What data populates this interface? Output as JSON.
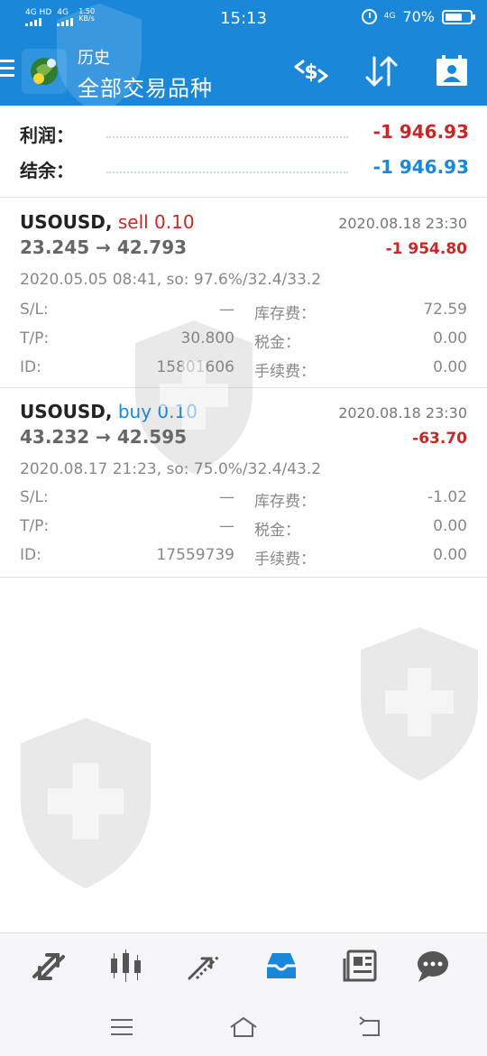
{
  "status_bar": {
    "sim1": "4G HD",
    "sim2": "4G",
    "speed_value": "1.50",
    "speed_unit": "KB/s",
    "time": "15:13",
    "network": "4G",
    "battery": "70%",
    "battery_level": 0.7,
    "icons": [
      "signal-icon",
      "alarm-icon",
      "battery-icon"
    ]
  },
  "app_bar": {
    "subtitle": "历史",
    "title": "全部交易品种",
    "colors": {
      "background": "#1a87d9",
      "text": "#ffffff"
    },
    "actions": [
      "currency-exchange-icon",
      "sort-icon",
      "calendar-icon"
    ]
  },
  "summary": {
    "profit_label": "利润：",
    "profit_value": "-1 946.93",
    "balance_label": "结余：",
    "balance_value": "-1 946.93"
  },
  "trades": [
    {
      "symbol": "USOUSD,",
      "side": "sell 0.10",
      "close_time": "2020.08.18 23:30",
      "prices": "23.245 → 42.793",
      "profit": "-1 954.80",
      "meta": "2020.05.05 08:41, so: 97.6%/32.4/33.2",
      "sl_label": "S/L:",
      "sl_value": "—",
      "swap_label": "库存费：",
      "swap_value": "72.59",
      "tp_label": "T/P:",
      "tp_value": "30.800",
      "tax_label": "税金：",
      "tax_value": "0.00",
      "id_label": "ID:",
      "id_value": "15801606",
      "fee_label": "手续费：",
      "fee_value": "0.00"
    },
    {
      "symbol": "USOUSD,",
      "side": "buy 0.10",
      "close_time": "2020.08.18 23:30",
      "prices": "43.232 → 42.595",
      "profit": "-63.70",
      "meta": "2020.08.17 21:23, so: 75.0%/32.4/43.2",
      "sl_label": "S/L:",
      "sl_value": "—",
      "swap_label": "库存费：",
      "swap_value": "-1.02",
      "tp_label": "T/P:",
      "tp_value": "—",
      "tax_label": "税金：",
      "tax_value": "0.00",
      "id_label": "ID:",
      "id_value": "17559739",
      "fee_label": "手续费：",
      "fee_value": "0.00"
    }
  ],
  "colors": {
    "negative": "#c62828",
    "accent": "#1a87d9",
    "muted": "#888888"
  },
  "bottom_nav": {
    "items": [
      "quotes-icon",
      "chart-icon",
      "trade-icon",
      "history-icon",
      "news-icon",
      "messages-icon"
    ],
    "active": "history-icon"
  },
  "system_nav": {
    "items": [
      "menu-icon",
      "home-icon",
      "back-icon"
    ]
  }
}
